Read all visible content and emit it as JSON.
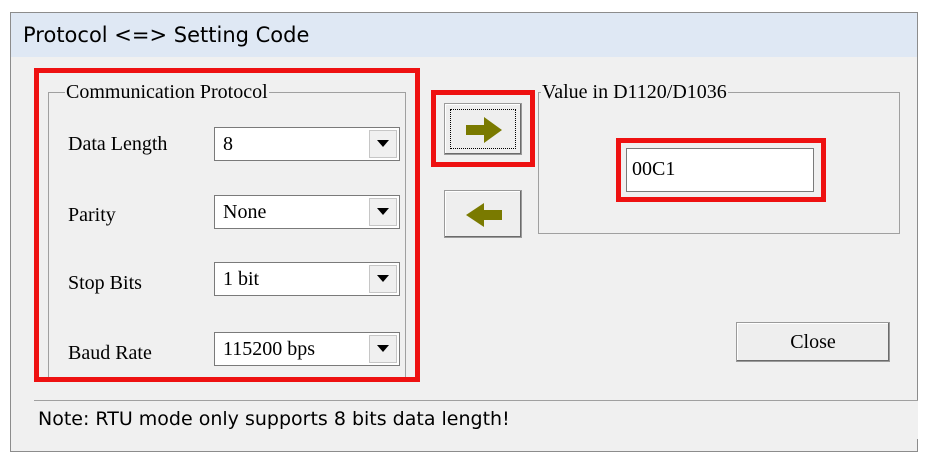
{
  "window": {
    "title": "Protocol <=> Setting Code"
  },
  "protocol_group": {
    "legend": "Communication Protocol",
    "fields": [
      {
        "label": "Data Length",
        "value": "8"
      },
      {
        "label": "Parity",
        "value": "None"
      },
      {
        "label": "Stop Bits",
        "value": "1 bit"
      },
      {
        "label": "Baud Rate",
        "value": "115200 bps"
      }
    ]
  },
  "value_group": {
    "legend": "Value in D1120/D1036",
    "value": "00C1"
  },
  "buttons": {
    "close_label": "Close",
    "to_code_icon": "right-arrow-icon",
    "to_protocol_icon": "left-arrow-icon",
    "arrow_color": "#7a7a00"
  },
  "status": {
    "note": "Note: RTU mode only supports 8 bits data length!"
  },
  "colors": {
    "highlight": "#ee1111",
    "titlebar": "#dfe8f4",
    "dialog": "#f0f0f0"
  }
}
